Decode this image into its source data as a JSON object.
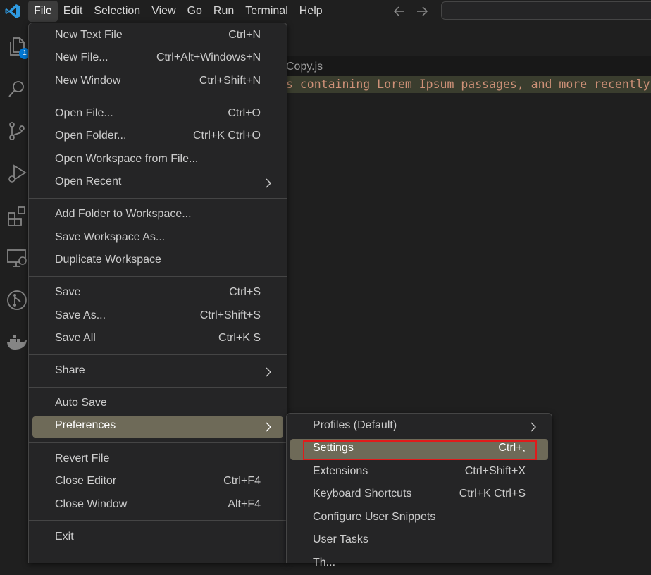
{
  "app": {
    "accent": "#0078d4"
  },
  "menubar": {
    "items": [
      "File",
      "Edit",
      "Selection",
      "View",
      "Go",
      "Run",
      "Terminal",
      "Help"
    ],
    "active": "File"
  },
  "activity": {
    "explorer_badge": "1"
  },
  "editor": {
    "tab_title": "Copy.js",
    "code_line": "s containing Lorem Ipsum passages, and more recently wi"
  },
  "file_menu": {
    "items": [
      {
        "label": "New Text File",
        "key": "Ctrl+N"
      },
      {
        "label": "New File...",
        "key": "Ctrl+Alt+Windows+N"
      },
      {
        "label": "New Window",
        "key": "Ctrl+Shift+N"
      },
      {
        "label": "Open File...",
        "key": "Ctrl+O"
      },
      {
        "label": "Open Folder...",
        "key": "Ctrl+K Ctrl+O"
      },
      {
        "label": "Open Workspace from File...",
        "key": ""
      },
      {
        "label": "Open Recent",
        "key": ""
      },
      {
        "label": "Add Folder to Workspace...",
        "key": ""
      },
      {
        "label": "Save Workspace As...",
        "key": ""
      },
      {
        "label": "Duplicate Workspace",
        "key": ""
      },
      {
        "label": "Save",
        "key": "Ctrl+S"
      },
      {
        "label": "Save As...",
        "key": "Ctrl+Shift+S"
      },
      {
        "label": "Save All",
        "key": "Ctrl+K S"
      },
      {
        "label": "Share",
        "key": ""
      },
      {
        "label": "Auto Save",
        "key": ""
      },
      {
        "label": "Preferences",
        "key": ""
      },
      {
        "label": "Revert File",
        "key": ""
      },
      {
        "label": "Close Editor",
        "key": "Ctrl+F4"
      },
      {
        "label": "Close Window",
        "key": "Alt+F4"
      },
      {
        "label": "Exit",
        "key": ""
      }
    ]
  },
  "preferences_menu": {
    "items": [
      {
        "label": "Profiles (Default)",
        "key": ""
      },
      {
        "label": "Settings",
        "key": "Ctrl+,"
      },
      {
        "label": "Extensions",
        "key": "Ctrl+Shift+X"
      },
      {
        "label": "Keyboard Shortcuts",
        "key": "Ctrl+K Ctrl+S"
      },
      {
        "label": "Configure User Snippets",
        "key": ""
      },
      {
        "label": "User Tasks",
        "key": ""
      },
      {
        "label": "Th...",
        "key": ""
      }
    ]
  }
}
